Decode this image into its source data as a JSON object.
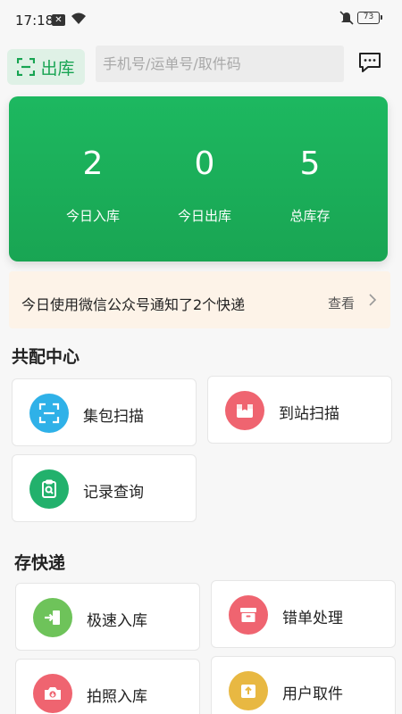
{
  "status_bar": {
    "time": "17:18",
    "battery": "73",
    "icons": [
      "notification-x-icon",
      "wifi-icon",
      "mute-icon",
      "battery-icon"
    ]
  },
  "top_bar": {
    "out_label": "出库",
    "search_placeholder": "手机号/运单号/取件码",
    "accent_color": "#17a452"
  },
  "stats": {
    "items": [
      {
        "value": "2",
        "label": "今日入库"
      },
      {
        "value": "0",
        "label": "今日出库"
      },
      {
        "value": "5",
        "label": "总库存"
      }
    ]
  },
  "notice": {
    "text": "今日使用微信公众号通知了2个快递",
    "action": "查看"
  },
  "section_shared": {
    "title": "共配中心",
    "tiles": [
      {
        "label": "集包扫描",
        "icon": "scan-icon",
        "color": "#2fb1e8"
      },
      {
        "label": "到站扫描",
        "icon": "parcel-icon",
        "color": "#ef6470"
      },
      {
        "label": "记录查询",
        "icon": "search-record-icon",
        "color": "#22b16c"
      }
    ]
  },
  "section_store": {
    "title": "存快递",
    "tiles": [
      {
        "label": "极速入库",
        "icon": "enter-icon",
        "color": "#6ec35a"
      },
      {
        "label": "错单处理",
        "icon": "archive-icon",
        "color": "#ef6470"
      },
      {
        "label": "拍照入库",
        "icon": "camera-icon",
        "color": "#ef6470"
      },
      {
        "label": "用户取件",
        "icon": "pickup-icon",
        "color": "#e8b842"
      }
    ]
  }
}
